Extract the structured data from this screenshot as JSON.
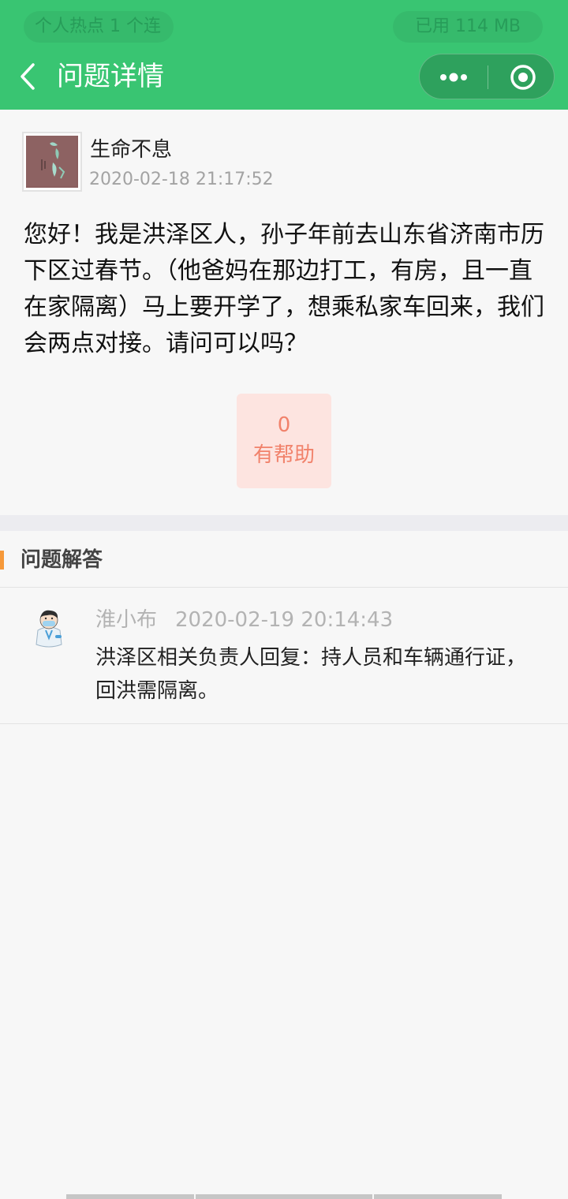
{
  "status_bar": {
    "left_text": "个人热点 1 个连",
    "right_text": "已用 114 MB"
  },
  "nav": {
    "title": "问题详情",
    "back_icon": "chevron-left-icon",
    "more_icon": "more-dots-icon",
    "close_icon": "target-close-icon"
  },
  "question": {
    "username": "生命不息",
    "time": "2020-02-18 21:17:52",
    "content": "您好！我是洪泽区人，孙子年前去山东省济南市历下区过春节。（他爸妈在那边打工，有房，且一直在家隔离）马上要开学了，想乘私家车回来，我们会两点对接。请问可以吗？",
    "helpful_count": "0",
    "helpful_label": "有帮助"
  },
  "answers": {
    "section_title": "问题解答",
    "items": [
      {
        "name": "淮小布",
        "time": "2020-02-19 20:14:43",
        "content": "洪泽区相关负责人回复：持人员和车辆通行证，回洪需隔离。"
      }
    ]
  },
  "colors": {
    "header_green": "#39c572",
    "helpful_bg": "#fde4e0",
    "helpful_text": "#f1826b",
    "section_marker": "#f6993a"
  }
}
